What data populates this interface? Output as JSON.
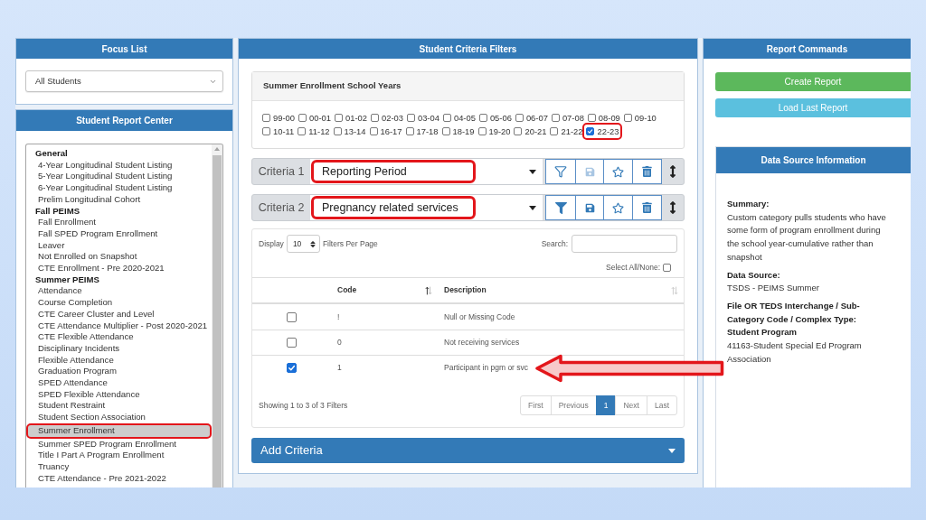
{
  "focus_list": {
    "title": "Focus List",
    "select": {
      "value": "All Students"
    }
  },
  "report_center": {
    "title": "Student Report Center",
    "groups": [
      {
        "label": "General",
        "items": [
          {
            "label": "4-Year Longitudinal Student Listing",
            "selected": false,
            "highlighted": false
          },
          {
            "label": "5-Year Longitudinal Student Listing",
            "selected": false,
            "highlighted": false
          },
          {
            "label": "6-Year Longitudinal Student Listing",
            "selected": false,
            "highlighted": false
          },
          {
            "label": "Prelim Longitudinal Cohort",
            "selected": false,
            "highlighted": false
          }
        ]
      },
      {
        "label": "Fall PEIMS",
        "items": [
          {
            "label": "Fall Enrollment",
            "selected": false,
            "highlighted": false
          },
          {
            "label": "Fall SPED Program Enrollment",
            "selected": false,
            "highlighted": false
          },
          {
            "label": "Leaver",
            "selected": false,
            "highlighted": false
          },
          {
            "label": "Not Enrolled on Snapshot",
            "selected": false,
            "highlighted": false
          },
          {
            "label": "CTE Enrollment - Pre 2020-2021",
            "selected": false,
            "highlighted": false
          }
        ]
      },
      {
        "label": "Summer PEIMS",
        "items": [
          {
            "label": "Attendance",
            "selected": false,
            "highlighted": false
          },
          {
            "label": "Course Completion",
            "selected": false,
            "highlighted": false
          },
          {
            "label": "CTE Career Cluster and Level",
            "selected": false,
            "highlighted": false
          },
          {
            "label": "CTE Attendance Multiplier - Post 2020-2021",
            "selected": false,
            "highlighted": false
          },
          {
            "label": "CTE Flexible Attendance",
            "selected": false,
            "highlighted": false
          },
          {
            "label": "Disciplinary Incidents",
            "selected": false,
            "highlighted": false
          },
          {
            "label": "Flexible Attendance",
            "selected": false,
            "highlighted": false
          },
          {
            "label": "Graduation Program",
            "selected": false,
            "highlighted": false
          },
          {
            "label": "SPED Attendance",
            "selected": false,
            "highlighted": false
          },
          {
            "label": "SPED Flexible Attendance",
            "selected": false,
            "highlighted": false
          },
          {
            "label": "Student Restraint",
            "selected": false,
            "highlighted": false
          },
          {
            "label": "Student Section Association",
            "selected": false,
            "highlighted": false
          },
          {
            "label": "Summer Enrollment",
            "selected": true,
            "highlighted": true
          },
          {
            "label": "Summer SPED Program Enrollment",
            "selected": false,
            "highlighted": false
          },
          {
            "label": "Title I Part A Program Enrollment",
            "selected": false,
            "highlighted": false
          },
          {
            "label": "Truancy",
            "selected": false,
            "highlighted": false
          },
          {
            "label": "CTE Attendance - Pre 2021-2022",
            "selected": false,
            "highlighted": false
          }
        ]
      }
    ]
  },
  "criteria_filters": {
    "title": "Student Criteria Filters",
    "years": {
      "title": "Summer Enrollment School Years",
      "items": [
        {
          "label": "99-00",
          "checked": false,
          "highlighted": false
        },
        {
          "label": "00-01",
          "checked": false,
          "highlighted": false
        },
        {
          "label": "01-02",
          "checked": false,
          "highlighted": false
        },
        {
          "label": "02-03",
          "checked": false,
          "highlighted": false
        },
        {
          "label": "03-04",
          "checked": false,
          "highlighted": false
        },
        {
          "label": "04-05",
          "checked": false,
          "highlighted": false
        },
        {
          "label": "05-06",
          "checked": false,
          "highlighted": false
        },
        {
          "label": "06-07",
          "checked": false,
          "highlighted": false
        },
        {
          "label": "07-08",
          "checked": false,
          "highlighted": false
        },
        {
          "label": "08-09",
          "checked": false,
          "highlighted": false
        },
        {
          "label": "09-10",
          "checked": false,
          "highlighted": false
        },
        {
          "label": "10-11",
          "checked": false,
          "highlighted": false
        },
        {
          "label": "11-12",
          "checked": false,
          "highlighted": false
        },
        {
          "label": "13-14",
          "checked": false,
          "highlighted": false
        },
        {
          "label": "16-17",
          "checked": false,
          "highlighted": false
        },
        {
          "label": "17-18",
          "checked": false,
          "highlighted": false
        },
        {
          "label": "18-19",
          "checked": false,
          "highlighted": false
        },
        {
          "label": "19-20",
          "checked": false,
          "highlighted": false
        },
        {
          "label": "20-21",
          "checked": false,
          "highlighted": false
        },
        {
          "label": "21-22",
          "checked": false,
          "highlighted": false
        },
        {
          "label": "22-23",
          "checked": true,
          "highlighted": true
        }
      ]
    },
    "criteria": [
      {
        "label": "Criteria 1",
        "value": "Reporting Period",
        "highlighted": true,
        "filter_active": false,
        "save_enabled": false
      },
      {
        "label": "Criteria 2",
        "value": "Pregnancy related services",
        "highlighted": true,
        "filter_active": true,
        "save_enabled": true
      }
    ],
    "table": {
      "display_label": "Display",
      "page_size": "10",
      "page_size_label": "Filters Per Page",
      "search_label": "Search:",
      "select_all": {
        "label": "Select All/None:",
        "checked": false
      },
      "columns": [
        {
          "label": "Code",
          "sorted": true
        },
        {
          "label": "Description",
          "sorted": false
        }
      ],
      "rows": [
        {
          "checked": false,
          "code": "!",
          "description": "Null or Missing Code",
          "pointed": false
        },
        {
          "checked": false,
          "code": "0",
          "description": "Not receiving services",
          "pointed": false
        },
        {
          "checked": true,
          "code": "1",
          "description": "Participant in pgm or svc",
          "pointed": true
        }
      ],
      "summary": "Showing 1 to 3 of 3 Filters",
      "pagination": [
        {
          "label": "First",
          "selected": false
        },
        {
          "label": "Previous",
          "selected": false
        },
        {
          "label": "1",
          "selected": true
        },
        {
          "label": "Next",
          "selected": false
        },
        {
          "label": "Last",
          "selected": false
        }
      ]
    },
    "add_criteria": {
      "label": "Add Criteria"
    }
  },
  "report_commands": {
    "title": "Report Commands",
    "buttons": [
      {
        "label": "Create Report",
        "kind": "success"
      },
      {
        "label": "Load Last Report",
        "kind": "info"
      }
    ],
    "data_source": {
      "title": "Data Source Information",
      "sections": [
        {
          "heading": "Summary:",
          "text": "Custom category pulls students who have some form of program enrollment during the school year-cumulative rather than snapshot"
        },
        {
          "heading": "Data Source:",
          "text": "TSDS - PEIMS Summer"
        },
        {
          "heading": "File OR TEDS Interchange / Sub-Category Code / Complex Type: Student Program",
          "text": "41163-Student Special Ed Program Association"
        }
      ]
    }
  }
}
